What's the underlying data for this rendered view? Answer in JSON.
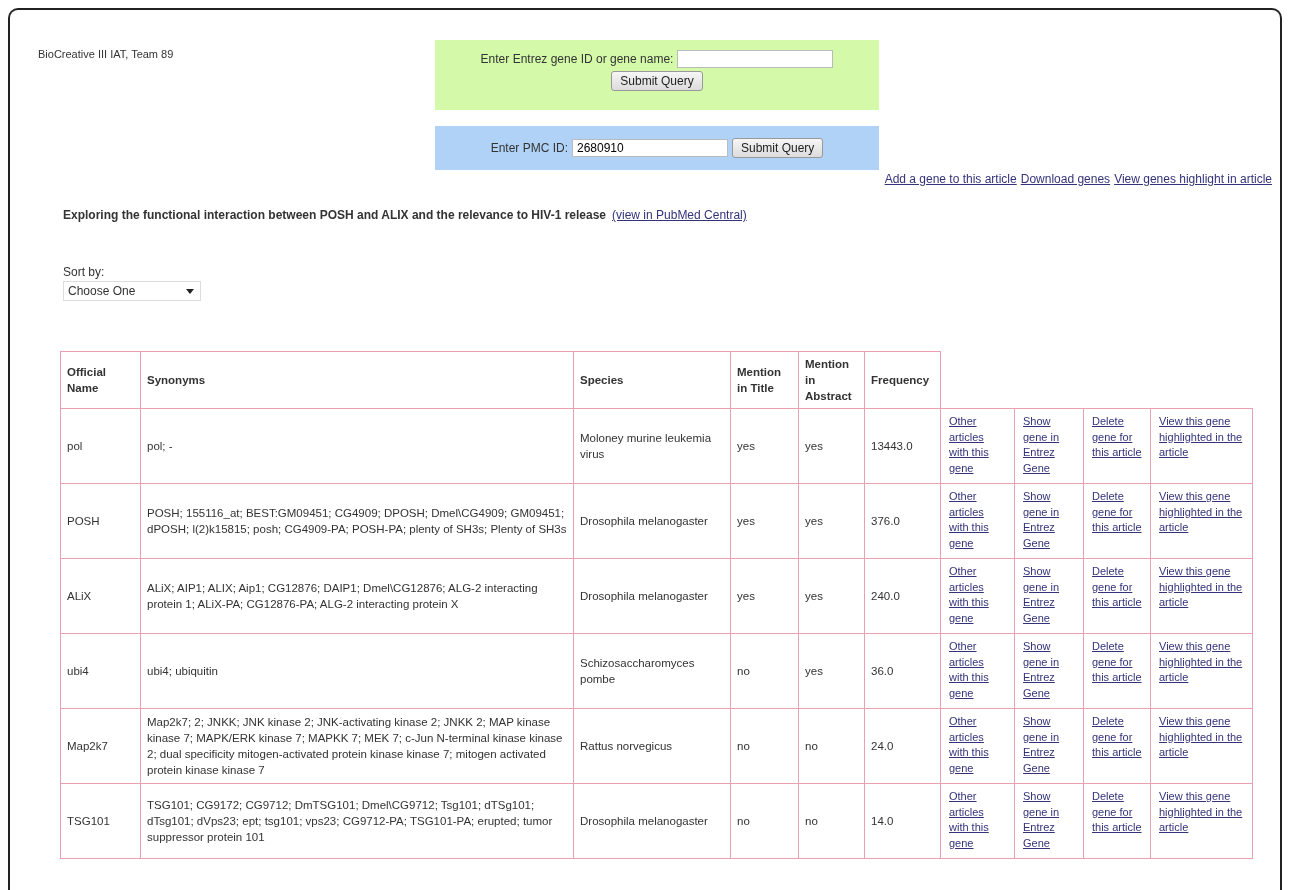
{
  "site_label": "BioCreative III IAT, Team 89",
  "gene_search": {
    "label": "Enter Entrez gene ID or gene name:",
    "button": "Submit Query"
  },
  "pmc_search": {
    "label": "Enter PMC ID:",
    "value": "2680910",
    "button": "Submit Query"
  },
  "article_links": [
    "Add a gene to this article",
    "Download genes",
    "View genes highlight in article"
  ],
  "article": {
    "title": "Exploring the functional interaction between POSH and ALIX and the relevance to HIV-1 release",
    "link": "(view in PubMed Central)"
  },
  "sort": {
    "label": "Sort by:",
    "value": "Choose One"
  },
  "table": {
    "columns": [
      "Official Name",
      "Synonyms",
      "Species",
      "Mention in Title",
      "Mention in Abstract",
      "Frequency"
    ],
    "rows": [
      {
        "name": "pol",
        "synonyms": "pol; -",
        "species": "Moloney murine leukemia virus",
        "title": "yes",
        "abstract": "yes",
        "frequency": "13443.0",
        "links": [
          "Other articles with this gene",
          "Show gene in Entrez Gene",
          "Delete gene for this article",
          "View this gene highlighted in the article"
        ]
      },
      {
        "name": "POSH",
        "synonyms": "POSH; 155116_at; BEST:GM09451; CG4909; DPOSH; Dmel\\CG4909; GM09451; dPOSH; l(2)k15815; posh; CG4909-PA; POSH-PA; plenty of SH3s; Plenty of SH3s",
        "species": "Drosophila melanogaster",
        "title": "yes",
        "abstract": "yes",
        "frequency": "376.0",
        "links": [
          "Other articles with this gene",
          "Show gene in Entrez Gene",
          "Delete gene for this article",
          "View this gene highlighted in the article"
        ]
      },
      {
        "name": "ALiX",
        "synonyms": "ALiX; AIP1; ALIX; Aip1; CG12876; DAIP1; Dmel\\CG12876; ALG-2 interacting protein 1; ALiX-PA; CG12876-PA; ALG-2 interacting protein X",
        "species": "Drosophila melanogaster",
        "title": "yes",
        "abstract": "yes",
        "frequency": "240.0",
        "links": [
          "Other articles with this gene",
          "Show gene in Entrez Gene",
          "Delete gene for this article",
          "View this gene highlighted in the article"
        ]
      },
      {
        "name": "ubi4",
        "synonyms": "ubi4; ubiquitin",
        "species": "Schizosaccharomyces pombe",
        "title": "no",
        "abstract": "yes",
        "frequency": "36.0",
        "links": [
          "Other articles with this gene",
          "Show gene in Entrez Gene",
          "Delete gene for this article",
          "View this gene highlighted in the article"
        ]
      },
      {
        "name": "Map2k7",
        "synonyms": "Map2k7; 2; JNKK; JNK kinase 2; JNK-activating kinase 2; JNKK 2; MAP kinase kinase 7; MAPK/ERK kinase 7; MAPKK 7; MEK 7; c-Jun N-terminal kinase kinase 2; dual specificity mitogen-activated protein kinase kinase 7; mitogen activated protein kinase kinase 7",
        "species": "Rattus norvegicus",
        "title": "no",
        "abstract": "no",
        "frequency": "24.0",
        "links": [
          "Other articles with this gene",
          "Show gene in Entrez Gene",
          "Delete gene for this article",
          "View this gene highlighted in the article"
        ]
      },
      {
        "name": "TSG101",
        "synonyms": "TSG101; CG9172; CG9712; DmTSG101; Dmel\\CG9712; Tsg101; dTSg101; dTsg101; dVps23; ept; tsg101; vps23; CG9712-PA; TSG101-PA; erupted; tumor suppressor protein 101",
        "species": "Drosophila melanogaster",
        "title": "no",
        "abstract": "no",
        "frequency": "14.0",
        "links": [
          "Other articles with this gene",
          "Show gene in Entrez Gene",
          "Delete gene for this article",
          "View this gene highlighted in the article"
        ]
      }
    ]
  }
}
